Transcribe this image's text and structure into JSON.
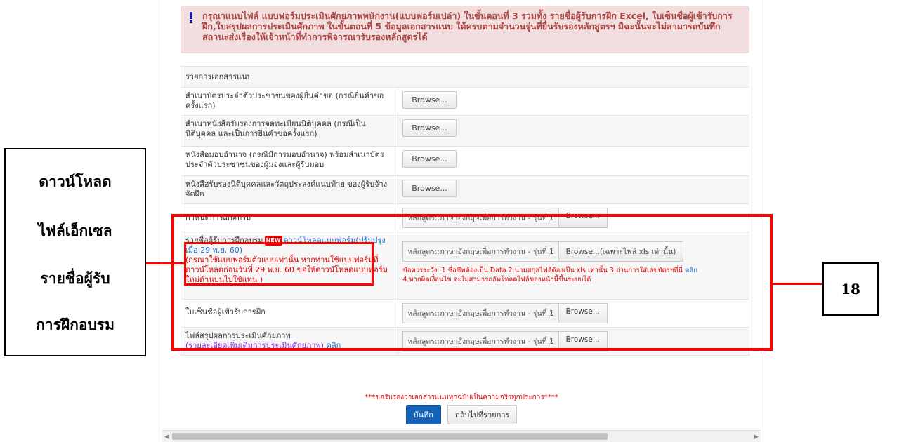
{
  "alert": {
    "text": "กรุณาแนบไฟล์ แบบฟอร์มประเมินศักยภาพพนักงาน(แบบฟอร์มเปล่า) ในขั้นตอนที่ 3 รวมทั้ง รายชื่อผู้รับการฝึก Excel, ใบเซ็นชื่อผู้เข้ารับการฝึก,ใบสรุปผลการประเมินศักภาพ ในขั้นตอนที่ 5 ข้อมูลเอกสารแนบ ให้ครบตามจำนวนรุ่นที่ยื่นรับรองหลักสูตรฯ มิฉะนั้นจะไม่สามารถบันทึกสถานะส่งเรื่องให้เจ้าหน้าที่ทำการพิจารณารับรองหลักสูตรได้"
  },
  "table": {
    "header": "รายการเอกสารแนบ",
    "browse": "Browse...",
    "course": "หลักสูตร::ภาษาอังกฤษเพื่อการทำงาน - รุ่นที่ 1",
    "rows": [
      {
        "label": "สำเนาบัตรประจำตัวประชาชนของผู้ยื่นคำขอ (กรณียื่นคำขอครั้งแรก)"
      },
      {
        "label": "สำเนาหนังสือรับรองการจดทะเบียนนิติบุคคล (กรณีเป็นนิติบุคคล และเป็นการยื่นคำขอครั้งแรก)"
      },
      {
        "label": "หนังสือมอบอำนาจ (กรณีมีการมอบอำนาจ) พร้อมสำเนาบัตรประจำตัวประชาชนของผู้มองและผู้รับมอบ"
      },
      {
        "label": "หนังสือรับรองนิติบุคคลและวัตถุประสงค์แนบท้าย ของผู้รับจ้างจัดฝึก"
      },
      {
        "label": "กำหนดการฝึกอบรม"
      },
      {
        "label_a": "รายชื่อผู้รับการฝึกอบรม",
        "badge": "NEW",
        "link": "ดาวน์โหลดแบบฟอร์ม(ปรับปรุงเมื่อ 29 พ.ย. 60)",
        "note_red": "(กรณาใช้แบบฟอร์มตัวแบบเท่านั้น หากท่านใช้แบบฟอร์มที่ดาวน์โหลดก่อนวันที่ 29 พ.ย. 60 ขอให้ดาวน์โหลดแบบฟอร์มใหม่ด้านบนไปใช้แทน )",
        "browse_xls": "Browse...(เฉพาะไฟล์ xls เท่านั้น)",
        "warn_a": "ข้อควรระวัง: 1.ชื่อชีทต้องเป็น Data 2.นามสกุลไฟล์ต้องเป็น xls เท่านั้น 3.อ่านการใส่เลขบัตรฯที่นี่",
        "warn_link": "คลิก",
        "warn_b": "4.หากผิดเงื่อนไข จะไม่สามารถอัพโหลดไฟล์ของหน้านี้ขึ้นระบบได้"
      },
      {
        "label": "ใบเซ็นชื่อผู้เข้ารับการฝึก"
      },
      {
        "label": "ไฟล์สรุปผลการประเมินศักยภาพ",
        "sub": "(รายละเอียดเพิ่มเติมการประเมินศักยภาพ)",
        "sub_link": "คลิก"
      }
    ]
  },
  "confirm": "***ขอรับรองว่าเอกสารแนบทุกฉบับเป็นความจริงทุกประการ****",
  "buttons": {
    "save": "บันทึก",
    "back": "กลับไปที่รายการ"
  },
  "callout_left": [
    "ดาวน์โหลด",
    "ไฟล์เอ็กเซล",
    "รายชื่อผู้รับ",
    "การฝึกอบรม"
  ],
  "callout_right": "18",
  "colors": {
    "annotation": "#ff0000",
    "save": "#1561b8",
    "alert_bg": "#f2dede"
  }
}
